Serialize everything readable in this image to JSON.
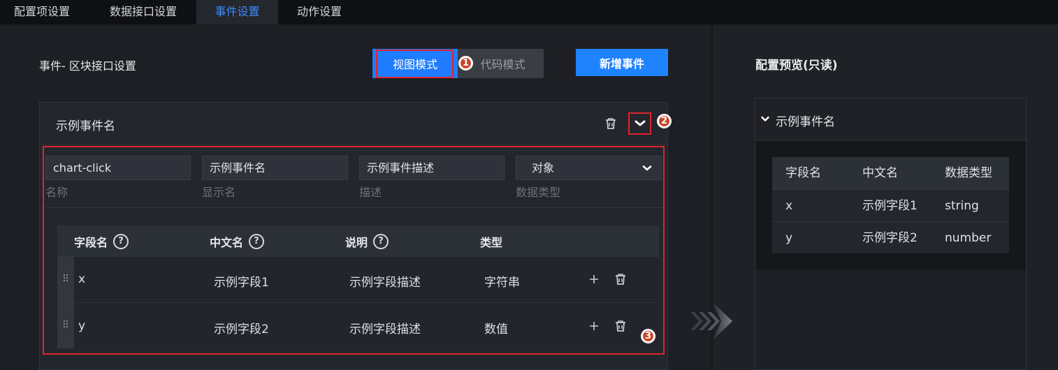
{
  "tabs": [
    {
      "label": "配置项设置",
      "active": false
    },
    {
      "label": "数据接口设置",
      "active": false
    },
    {
      "label": "事件设置",
      "active": true
    },
    {
      "label": "动作设置",
      "active": false
    }
  ],
  "left": {
    "section_title": "事件- 区块接口设置",
    "view_mode_label": "视图模式",
    "code_mode_label": "代码模式",
    "add_event_label": "新增事件",
    "badges": [
      "1",
      "2",
      "3"
    ],
    "event": {
      "name": "示例事件名",
      "fields": {
        "name_value": "chart-click",
        "name_label": "名称",
        "display_value": "示例事件名",
        "display_label": "显示名",
        "desc_value": "示例事件描述",
        "desc_label": "描述",
        "type_value": "对象",
        "type_label": "数据类型"
      },
      "table": {
        "headers": [
          "字段名",
          "中文名",
          "说明",
          "类型"
        ],
        "rows": [
          {
            "field": "x",
            "cn": "示例字段1",
            "desc": "示例字段描述",
            "type": "字符串"
          },
          {
            "field": "y",
            "cn": "示例字段2",
            "desc": "示例字段描述",
            "type": "数值"
          }
        ]
      }
    }
  },
  "right": {
    "title": "配置预览(只读)",
    "event_name": "示例事件名",
    "table": {
      "headers": [
        "字段名",
        "中文名",
        "数据类型"
      ],
      "rows": [
        [
          "x",
          "示例字段1",
          "string"
        ],
        [
          "y",
          "示例字段2",
          "number"
        ]
      ]
    }
  },
  "colors": {
    "accent": "#1f82ff",
    "active_tab_text": "#3b8cff",
    "annotation_red": "#e0242f",
    "badge": "#c8462c"
  }
}
